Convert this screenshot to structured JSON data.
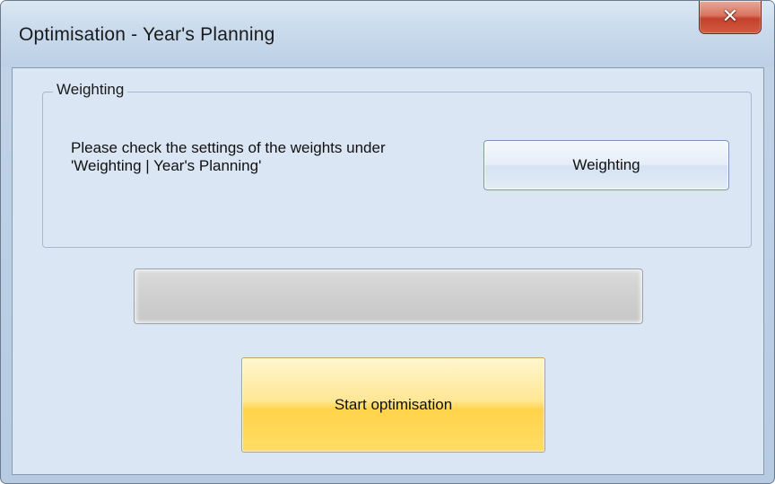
{
  "window": {
    "title": "Optimisation - Year's Planning",
    "close_icon": "x-icon"
  },
  "weighting_group": {
    "label": "Weighting",
    "instruction_line1": "Please check the settings of the weights under",
    "instruction_line2": "'Weighting | Year's Planning'",
    "button_label": "Weighting"
  },
  "progress": {
    "value": 0
  },
  "actions": {
    "start_label": "Start optimisation"
  },
  "colors": {
    "start_button": "#ffd44a",
    "close_button": "#c3412c",
    "client_background": "#dbe6f4"
  }
}
